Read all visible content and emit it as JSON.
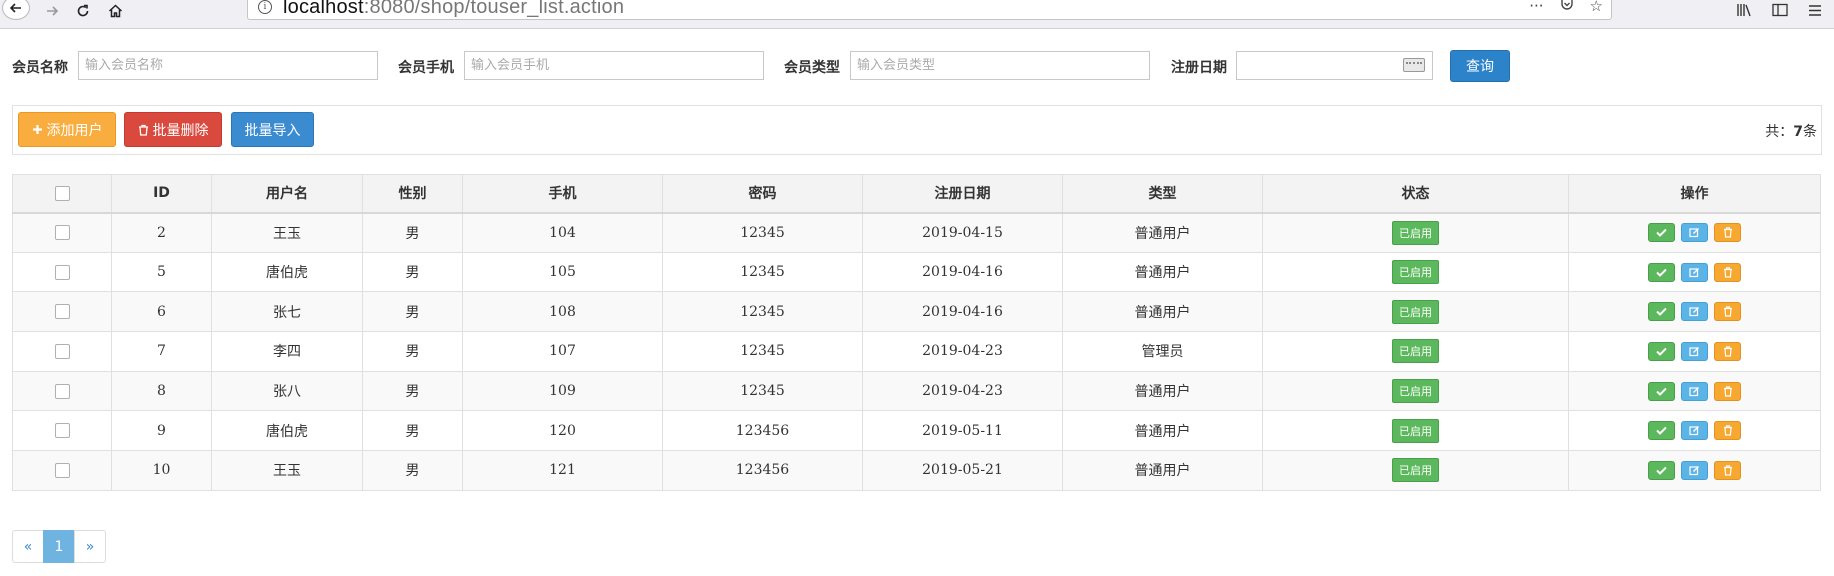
{
  "browser": {
    "url_host": "localhost",
    "url_rest": ":8080/shop/touser_list.action"
  },
  "search": {
    "name_label": "会员名称",
    "name_placeholder": "输入会员名称",
    "phone_label": "会员手机",
    "phone_placeholder": "输入会员手机",
    "type_label": "会员类型",
    "type_placeholder": "输入会员类型",
    "date_label": "注册日期",
    "date_value": "",
    "query_label": "查询"
  },
  "toolbar": {
    "add_label": "添加用户",
    "batch_delete_label": "批量删除",
    "batch_import_label": "批量导入",
    "total_prefix": "共：",
    "total_count": "7",
    "total_suffix": "条"
  },
  "table": {
    "columns": [
      "ID",
      "用户名",
      "性别",
      "手机",
      "密码",
      "注册日期",
      "类型",
      "状态",
      "操作"
    ],
    "rows": [
      {
        "id": "2",
        "username": "王玉",
        "gender": "男",
        "phone": "104",
        "password": "12345",
        "reg_date": "2019-04-15",
        "type": "普通用户",
        "status": "已启用"
      },
      {
        "id": "5",
        "username": "唐伯虎",
        "gender": "男",
        "phone": "105",
        "password": "12345",
        "reg_date": "2019-04-16",
        "type": "普通用户",
        "status": "已启用"
      },
      {
        "id": "6",
        "username": "张七",
        "gender": "男",
        "phone": "108",
        "password": "12345",
        "reg_date": "2019-04-16",
        "type": "普通用户",
        "status": "已启用"
      },
      {
        "id": "7",
        "username": "李四",
        "gender": "男",
        "phone": "107",
        "password": "12345",
        "reg_date": "2019-04-23",
        "type": "管理员",
        "status": "已启用"
      },
      {
        "id": "8",
        "username": "张八",
        "gender": "男",
        "phone": "109",
        "password": "12345",
        "reg_date": "2019-04-23",
        "type": "普通用户",
        "status": "已启用"
      },
      {
        "id": "9",
        "username": "唐伯虎",
        "gender": "男",
        "phone": "120",
        "password": "123456",
        "reg_date": "2019-05-11",
        "type": "普通用户",
        "status": "已启用"
      },
      {
        "id": "10",
        "username": "王玉",
        "gender": "男",
        "phone": "121",
        "password": "123456",
        "reg_date": "2019-05-21",
        "type": "普通用户",
        "status": "已启用"
      }
    ]
  },
  "pagination": {
    "prev": "«",
    "current": "1",
    "next": "»"
  },
  "icons": {
    "add": "plus-icon",
    "delete": "trash-icon",
    "enable": "check-icon",
    "edit": "edit-icon",
    "remove": "trash-icon"
  },
  "colors": {
    "primary": "#2d83c9",
    "warning": "#f9ad3f",
    "danger": "#d9493d",
    "success": "#5cb85c",
    "info": "#5bb4e5"
  }
}
